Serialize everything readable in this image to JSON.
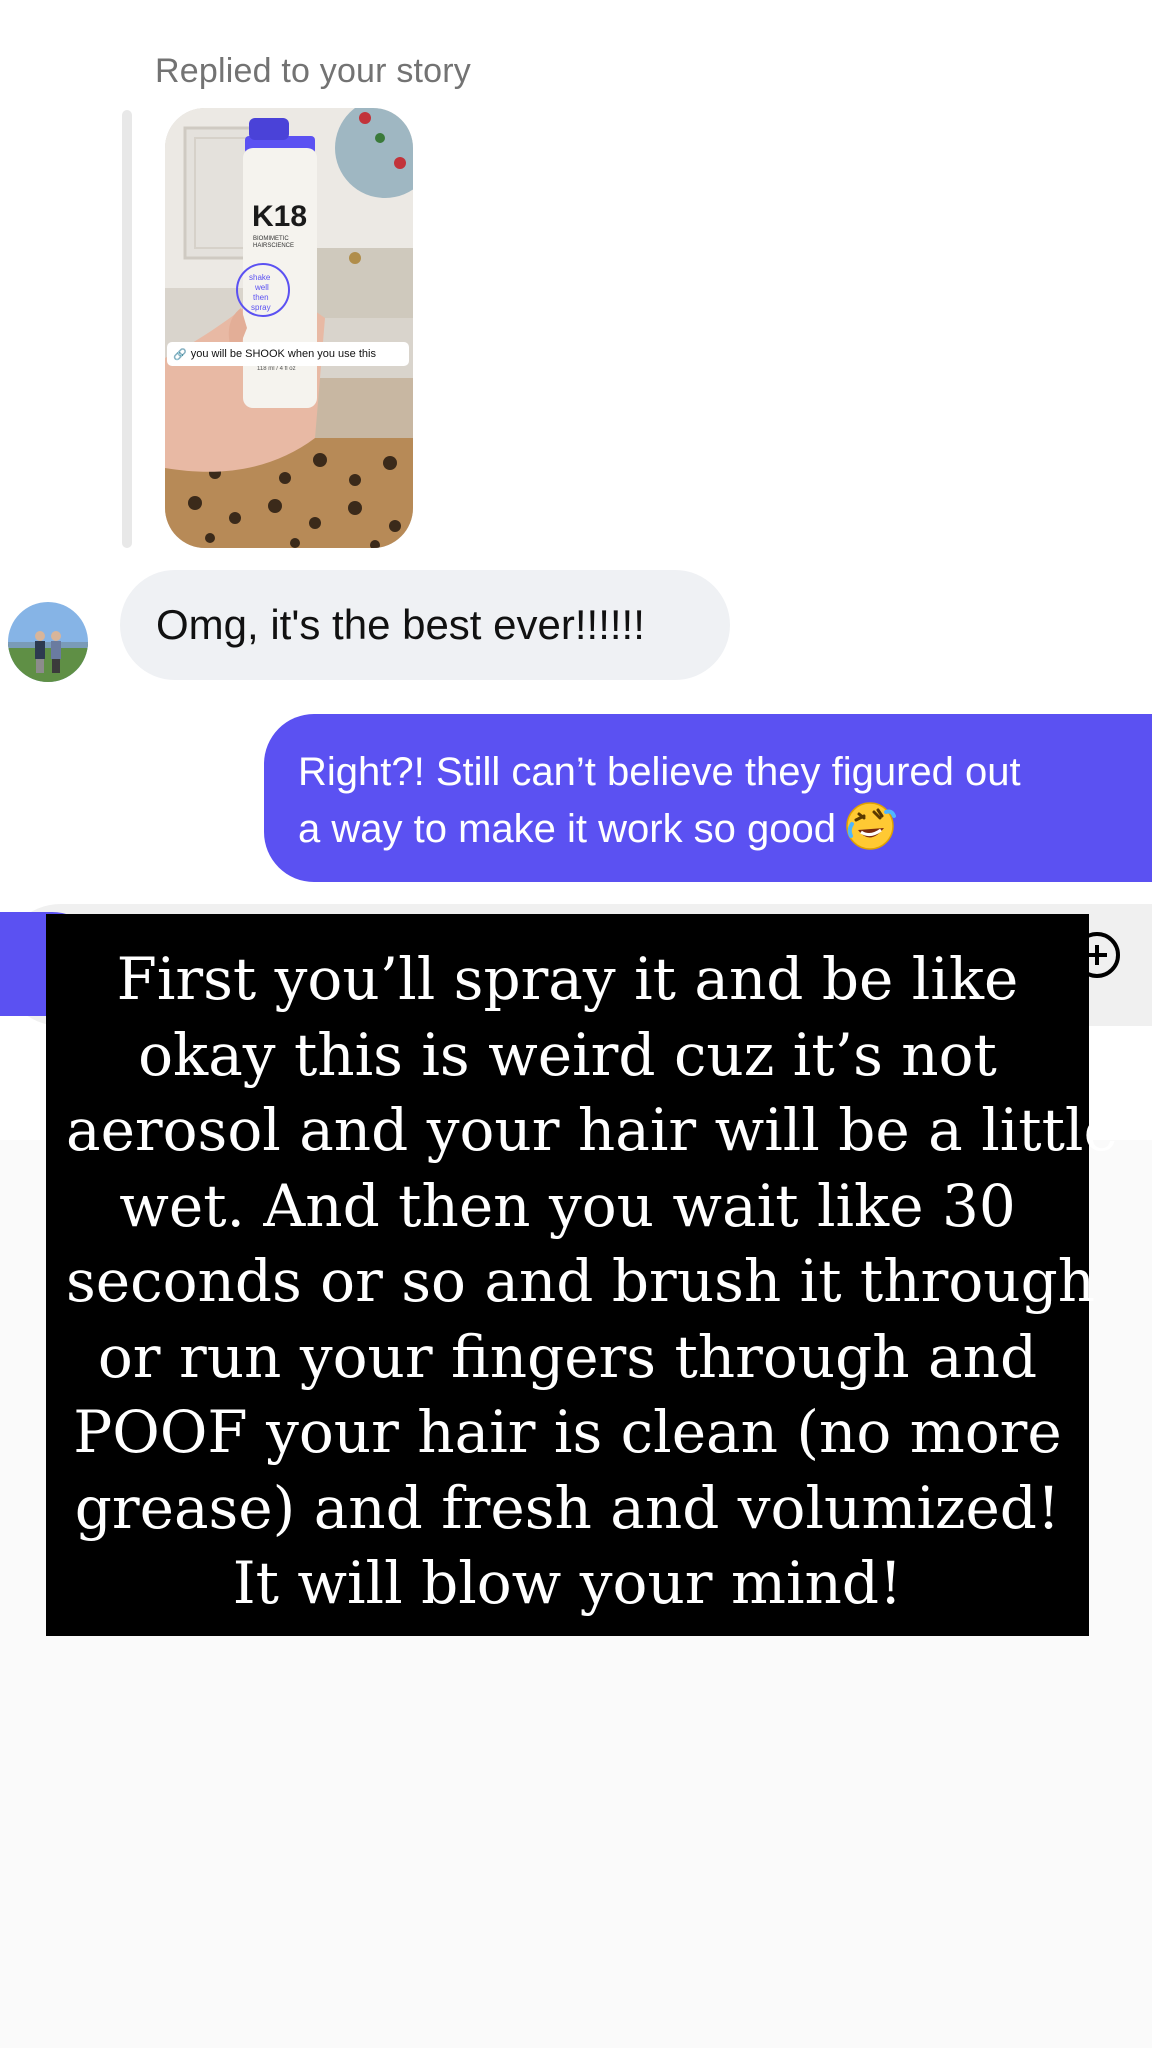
{
  "thread": {
    "replied_label": "Replied to your story",
    "story": {
      "brand": "K18",
      "brand_sub": "BIOMIMETIC HAIRSCIENCE",
      "bottle_label_lines": [
        "shake",
        "well",
        "then",
        "spray"
      ],
      "volume": "118 ml / 4 fl oz",
      "sticker_icon": "link-icon",
      "sticker_text": "you will be SHOOK when you use this"
    },
    "incoming_message": "Omg, it's the best ever!!!!!!",
    "outgoing_message": {
      "line1": "Right?! Still can’t believe they figured out",
      "line2": "a way to make it work so good",
      "emoji": "rolling-on-floor-laughing"
    }
  },
  "composer": {
    "left_icon": "camera-icon",
    "right_icon": "add-icon",
    "accent": "#5b51f2"
  },
  "overlay": {
    "lines": [
      "First you’ll spray it and be like",
      "okay this is weird cuz it’s not",
      "aerosol and your hair will be a little",
      "wet. And then you wait like 30",
      "seconds or so and brush it through",
      "or run your fingers through and",
      "POOF your hair is clean (no more",
      "grease) and fresh and volumized!",
      "It will blow your mind!"
    ]
  },
  "colors": {
    "outgoing_bubble": "#5b51f2",
    "incoming_bubble": "#eff1f4",
    "overlay_bg": "#000000",
    "secondary_text": "#737373"
  }
}
